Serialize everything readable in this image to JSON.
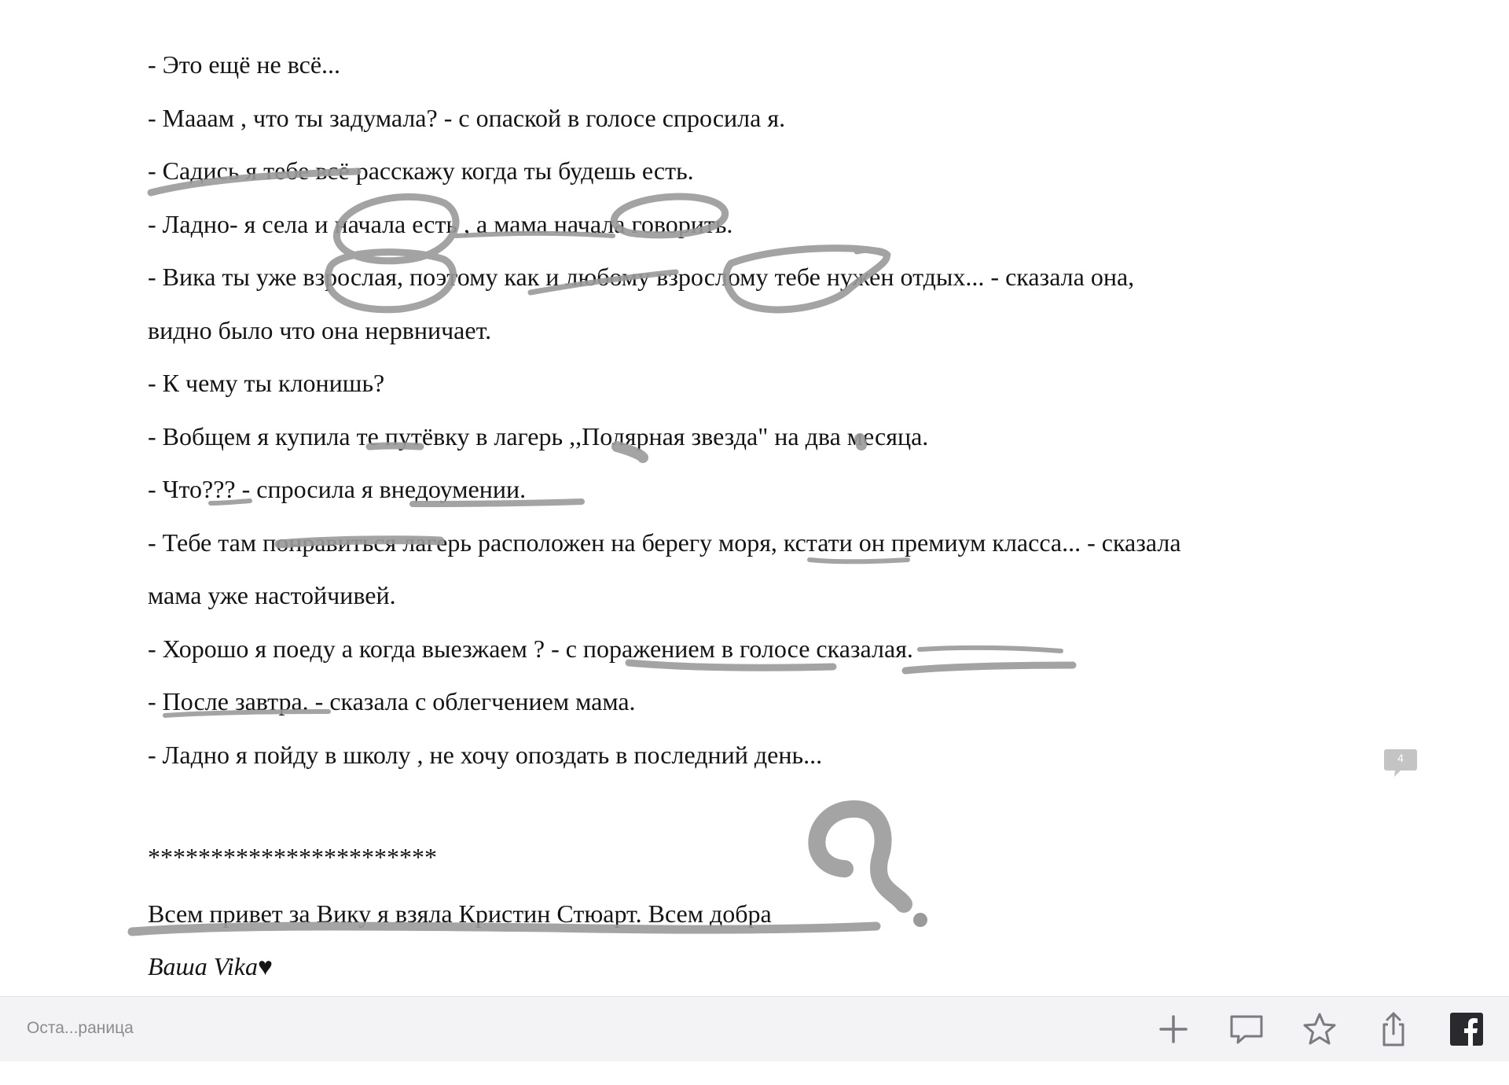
{
  "story": {
    "lines": [
      "- Это ещё не всё...",
      "- Маaам , что ты задумала? - с опаской в голосе спросила я.",
      "- Садись я тебе всё расскажу когда ты будешь есть.",
      "- Ладно- я села и начала есть , а мама начала говорить.",
      "- Вика ты уже взрослая, поэтому как и любому взрослому тебе нужен отдых... - сказала она,",
      "видно было что она нервничает.",
      "- К чему ты клонишь?",
      "- Вобщем я купила те путёвку в лагерь ,,Полярная звезда\" на два месяца.",
      "- Что??? - спросила я внедоумении.",
      "- Тебе там понравиться лагерь расположен на берегу моря, кстати он премиум класса... - сказала",
      "мама уже настойчивей.",
      "- Хорошо я поеду а когда выезжаем ? - с поражением в голосе сказалая.",
      "- После завтра. - сказала с облегчением мама.",
      "- Ладно я пойду в школу , не хочу опоздать в последний день..."
    ],
    "separator": "***********************",
    "author_note": "Всем привет за Вику я взяла Кристин Стюарт. Всем добра",
    "signature": "Ваша Vika♥"
  },
  "comment_badge": {
    "count": "4"
  },
  "bottom_bar": {
    "status": "Оста...раница",
    "icons": [
      "plus-icon",
      "comment-icon",
      "star-icon",
      "share-icon",
      "facebook-icon"
    ]
  },
  "colors": {
    "scribble": "#9a9a9a",
    "bar_background": "#f3f3f5",
    "icon": "#7a7a80"
  }
}
